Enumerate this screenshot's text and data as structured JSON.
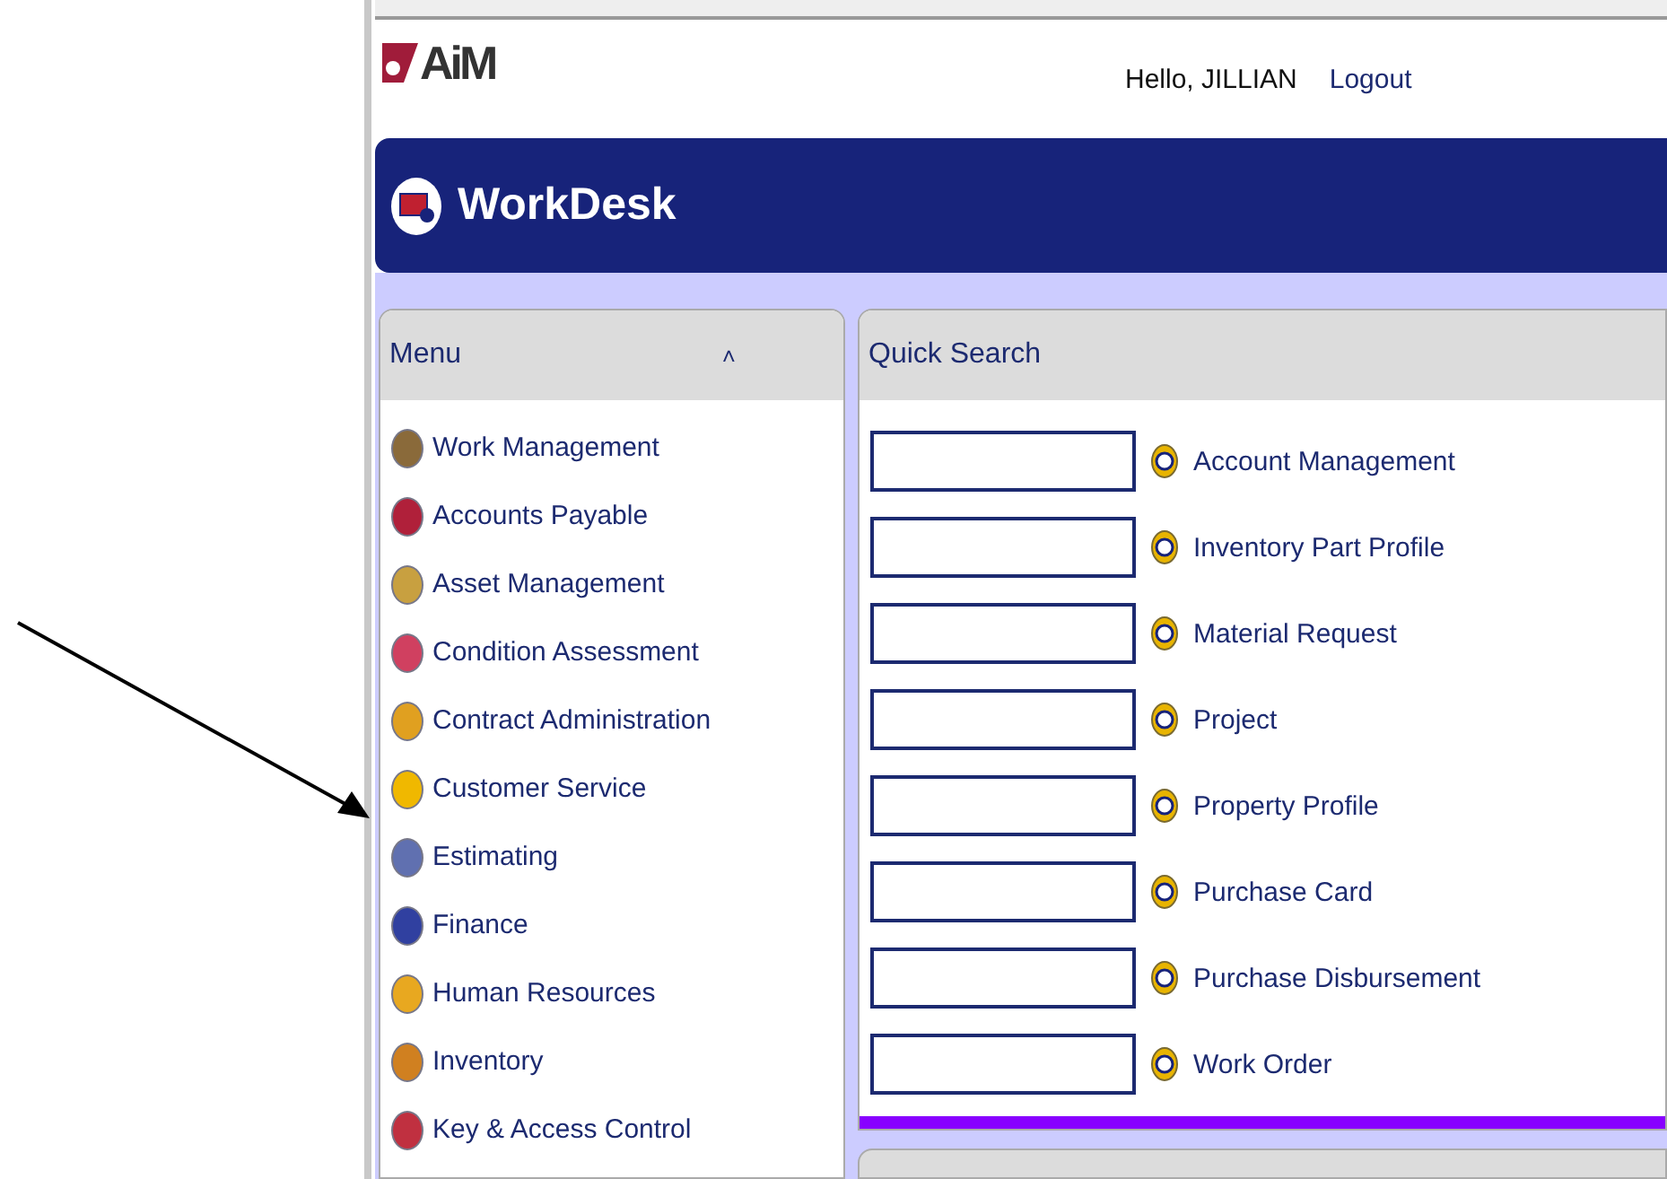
{
  "header": {
    "logo": "AiM",
    "greeting": "Hello, JILLIAN",
    "logout": "Logout"
  },
  "banner": {
    "title": "WorkDesk"
  },
  "menu": {
    "title": "Menu",
    "toggle": "˄",
    "items": [
      {
        "label": "Work Management",
        "color": "#8a6a3a"
      },
      {
        "label": "Accounts Payable",
        "color": "#b0203a"
      },
      {
        "label": "Asset Management",
        "color": "#c8a040"
      },
      {
        "label": "Condition Assessment",
        "color": "#d04060"
      },
      {
        "label": "Contract Administration",
        "color": "#e0a020"
      },
      {
        "label": "Customer Service",
        "color": "#f0b800"
      },
      {
        "label": "Estimating",
        "color": "#6070b0"
      },
      {
        "label": "Finance",
        "color": "#3040a0"
      },
      {
        "label": "Human Resources",
        "color": "#e8a820"
      },
      {
        "label": "Inventory",
        "color": "#d08020"
      },
      {
        "label": "Key & Access Control",
        "color": "#c03040"
      }
    ]
  },
  "quick_search": {
    "title": "Quick Search",
    "rows": [
      {
        "label": "Account Management"
      },
      {
        "label": "Inventory Part Profile"
      },
      {
        "label": "Material Request"
      },
      {
        "label": "Project"
      },
      {
        "label": "Property Profile"
      },
      {
        "label": "Purchase Card"
      },
      {
        "label": "Purchase Disbursement"
      },
      {
        "label": "Work Order"
      }
    ]
  }
}
